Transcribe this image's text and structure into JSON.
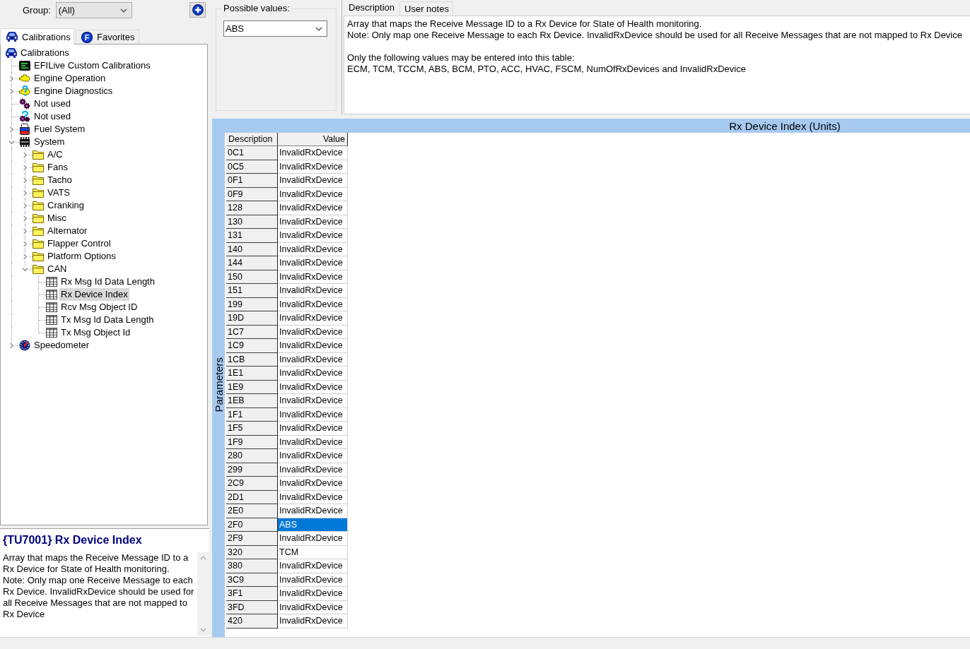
{
  "toolbar": {
    "group_label": "Group:",
    "group_value": "(All)"
  },
  "left_tabs": [
    {
      "label": "Calibrations",
      "kind": "car",
      "selected": true
    },
    {
      "label": "Favorites",
      "kind": "letter",
      "letter": "F",
      "selected": false
    }
  ],
  "tree": {
    "items": [
      {
        "label": "Calibrations",
        "kind": "car",
        "selected": false,
        "children": [
          {
            "label": "EFILive Custom Calibrations",
            "kind": "screen",
            "selected": false
          },
          {
            "label": "Engine Operation",
            "kind": "engine",
            "expanded": false,
            "selected": false
          },
          {
            "label": "Engine Diagnostics",
            "kind": "engine-help",
            "expanded": false,
            "selected": false
          },
          {
            "label": "Not used",
            "kind": "gears",
            "selected": false
          },
          {
            "label": "Not used",
            "kind": "gears-help",
            "selected": false
          },
          {
            "label": "Fuel System",
            "kind": "fuel",
            "expanded": false,
            "selected": false
          },
          {
            "label": "System",
            "kind": "chip",
            "expanded": true,
            "selected": false,
            "children": [
              {
                "label": "A/C",
                "kind": "folder",
                "expanded": false,
                "selected": false
              },
              {
                "label": "Fans",
                "kind": "folder",
                "expanded": false,
                "selected": false
              },
              {
                "label": "Tacho",
                "kind": "folder",
                "expanded": false,
                "selected": false
              },
              {
                "label": "VATS",
                "kind": "folder",
                "expanded": false,
                "selected": false
              },
              {
                "label": "Cranking",
                "kind": "folder",
                "expanded": false,
                "selected": false
              },
              {
                "label": "Misc",
                "kind": "folder",
                "expanded": false,
                "selected": false
              },
              {
                "label": "Alternator",
                "kind": "folder",
                "expanded": false,
                "selected": false
              },
              {
                "label": "Flapper Control",
                "kind": "folder",
                "expanded": false,
                "selected": false
              },
              {
                "label": "Platform Options",
                "kind": "folder",
                "expanded": false,
                "selected": false
              },
              {
                "label": "CAN",
                "kind": "folder",
                "expanded": true,
                "selected": false,
                "children": [
                  {
                    "label": "Rx Msg Id Data Length",
                    "kind": "table",
                    "selected": false
                  },
                  {
                    "label": "Rx Device Index",
                    "kind": "table",
                    "selected": true
                  },
                  {
                    "label": "Rcv Msg Object ID",
                    "kind": "table",
                    "selected": false
                  },
                  {
                    "label": "Tx Msg Id Data Length",
                    "kind": "table",
                    "selected": false
                  },
                  {
                    "label": "Tx Msg Object Id",
                    "kind": "table",
                    "selected": false
                  }
                ]
              }
            ]
          },
          {
            "label": "Speedometer",
            "kind": "gauge",
            "expanded": false,
            "selected": false
          }
        ]
      }
    ]
  },
  "info": {
    "title": "{TU7001} Rx Device Index",
    "text": "Array that maps the Receive Message ID to a Rx Device for State of Health monitoring.\nNote: Only map one Receive Message to each Rx Device. InvalidRxDevice should be used for all Receive Messages that are not mapped to Rx Device"
  },
  "possible_values": {
    "label": "Possible values:",
    "value": "ABS"
  },
  "description": {
    "tabs": [
      {
        "label": "Description",
        "selected": true
      },
      {
        "label": "User notes",
        "selected": false
      }
    ],
    "paragraphs": [
      "Array that maps the Receive Message ID to a Rx Device for State of Health monitoring.\nNote: Only map one Receive Message to each Rx Device. InvalidRxDevice should be used for all Receive Messages that are not mapped to Rx Device",
      "Only the following values may be entered into this table:\nECM, TCM, TCCM, ABS, BCM, PTO, ACC, HVAC, FSCM, NumOfRxDevices and InvalidRxDevice"
    ]
  },
  "table": {
    "title": "Rx Device Index (Units)",
    "side_label": "Parameters",
    "columns": [
      "Description",
      "Value"
    ],
    "rows": [
      {
        "description": "0C1",
        "value": "InvalidRxDevice",
        "selected": false
      },
      {
        "description": "0C5",
        "value": "InvalidRxDevice",
        "selected": false
      },
      {
        "description": "0F1",
        "value": "InvalidRxDevice",
        "selected": false
      },
      {
        "description": "0F9",
        "value": "InvalidRxDevice",
        "selected": false
      },
      {
        "description": "128",
        "value": "InvalidRxDevice",
        "selected": false
      },
      {
        "description": "130",
        "value": "InvalidRxDevice",
        "selected": false
      },
      {
        "description": "131",
        "value": "InvalidRxDevice",
        "selected": false
      },
      {
        "description": "140",
        "value": "InvalidRxDevice",
        "selected": false
      },
      {
        "description": "144",
        "value": "InvalidRxDevice",
        "selected": false
      },
      {
        "description": "150",
        "value": "InvalidRxDevice",
        "selected": false
      },
      {
        "description": "151",
        "value": "InvalidRxDevice",
        "selected": false
      },
      {
        "description": "199",
        "value": "InvalidRxDevice",
        "selected": false
      },
      {
        "description": "19D",
        "value": "InvalidRxDevice",
        "selected": false
      },
      {
        "description": "1C7",
        "value": "InvalidRxDevice",
        "selected": false
      },
      {
        "description": "1C9",
        "value": "InvalidRxDevice",
        "selected": false
      },
      {
        "description": "1CB",
        "value": "InvalidRxDevice",
        "selected": false
      },
      {
        "description": "1E1",
        "value": "InvalidRxDevice",
        "selected": false
      },
      {
        "description": "1E9",
        "value": "InvalidRxDevice",
        "selected": false
      },
      {
        "description": "1EB",
        "value": "InvalidRxDevice",
        "selected": false
      },
      {
        "description": "1F1",
        "value": "InvalidRxDevice",
        "selected": false
      },
      {
        "description": "1F5",
        "value": "InvalidRxDevice",
        "selected": false
      },
      {
        "description": "1F9",
        "value": "InvalidRxDevice",
        "selected": false
      },
      {
        "description": "280",
        "value": "InvalidRxDevice",
        "selected": false
      },
      {
        "description": "299",
        "value": "InvalidRxDevice",
        "selected": false
      },
      {
        "description": "2C9",
        "value": "InvalidRxDevice",
        "selected": false
      },
      {
        "description": "2D1",
        "value": "InvalidRxDevice",
        "selected": false
      },
      {
        "description": "2E0",
        "value": "InvalidRxDevice",
        "selected": false
      },
      {
        "description": "2F0",
        "value": "ABS",
        "selected": true
      },
      {
        "description": "2F9",
        "value": "InvalidRxDevice",
        "selected": false
      },
      {
        "description": "320",
        "value": "TCM",
        "selected": false
      },
      {
        "description": "380",
        "value": "InvalidRxDevice",
        "selected": false
      },
      {
        "description": "3C9",
        "value": "InvalidRxDevice",
        "selected": false
      },
      {
        "description": "3F1",
        "value": "InvalidRxDevice",
        "selected": false
      },
      {
        "description": "3FD",
        "value": "InvalidRxDevice",
        "selected": false
      },
      {
        "description": "420",
        "value": "InvalidRxDevice",
        "selected": false
      }
    ]
  }
}
